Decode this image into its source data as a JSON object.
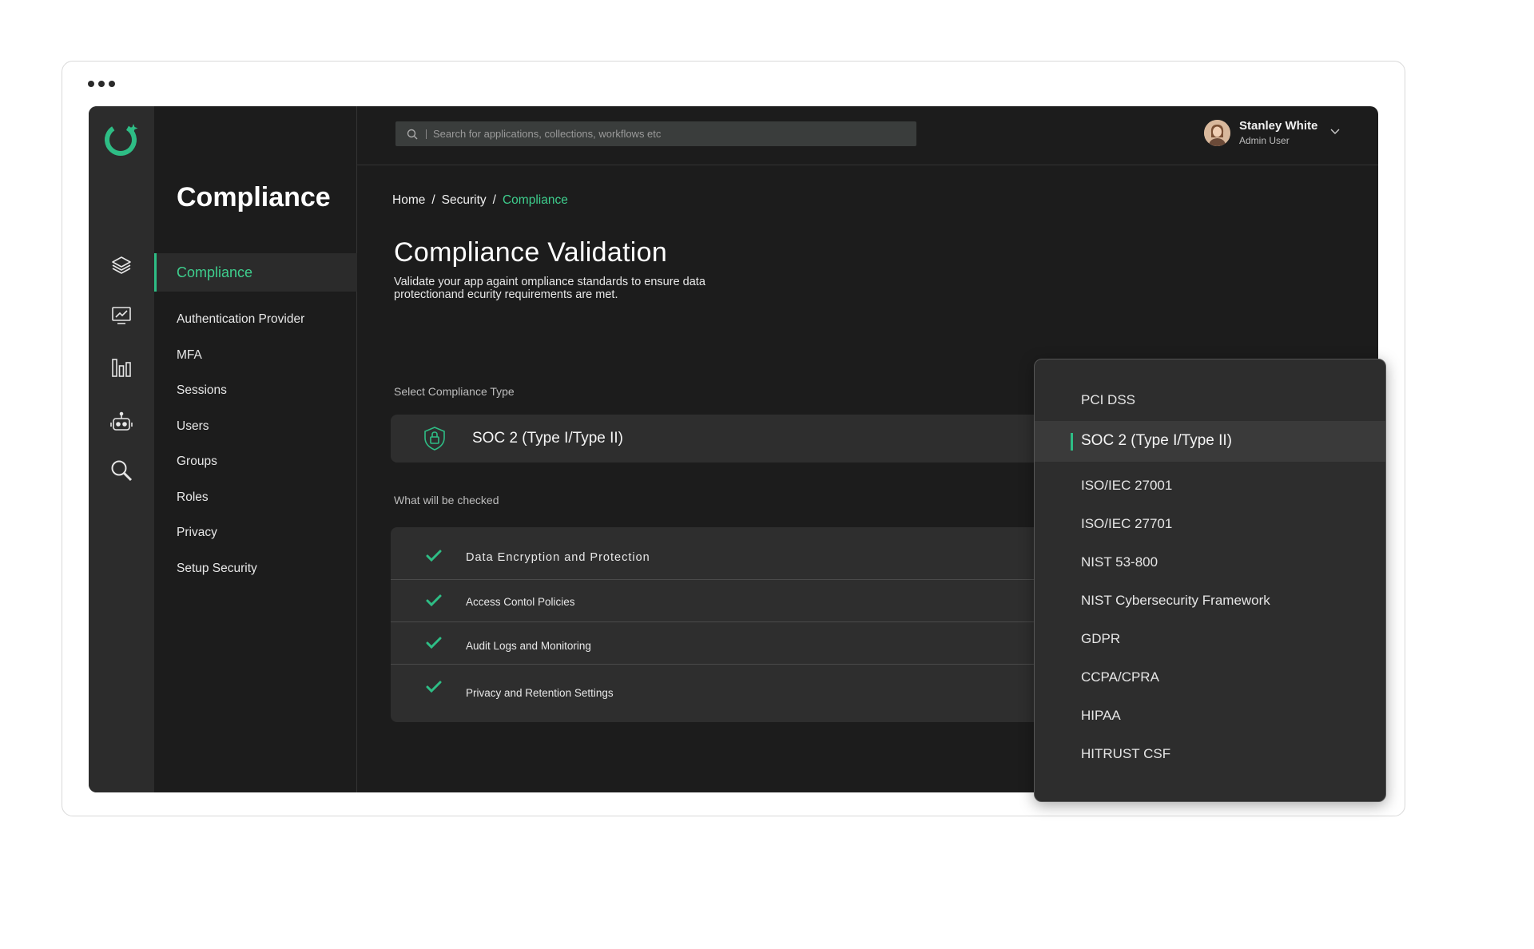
{
  "app": {
    "section_title": "Compliance",
    "brand_color": "#2ebd85"
  },
  "rail": {
    "icons": [
      "layers-icon",
      "monitor-chart-icon",
      "bar-chart-icon",
      "robot-icon",
      "search-icon"
    ]
  },
  "subnav": {
    "active": "Compliance",
    "items": [
      "Authentication Provider",
      "MFA",
      "Sessions",
      "Users",
      "Groups",
      "Roles",
      "Privacy",
      "Setup Security"
    ]
  },
  "search": {
    "placeholder": "Search for applications, collections, workflows etc"
  },
  "user": {
    "name": "Stanley White",
    "role": "Admin User"
  },
  "breadcrumb": {
    "home": "Home",
    "sep1": "/",
    "security": "Security",
    "sep2": "/",
    "current": "Compliance"
  },
  "main": {
    "title": "Compliance Validation",
    "description": "Validate your app againt ompliance standards to ensure data protectionand ecurity requirements are met.",
    "select_label": "Select Compliance Type",
    "selected_value": "SOC 2 (Type I/Type II)",
    "checked_label": "What will be checked",
    "checks": [
      "Data Encryption and Protection",
      "Access Contol Policies",
      "Audit Logs and Monitoring",
      "Privacy and Retention Settings"
    ]
  },
  "dropdown": {
    "options": [
      "PCI DSS",
      "SOC 2 (Type I/Type II)",
      "ISO/IEC 27001",
      "ISO/IEC 27701",
      "NIST 53-800",
      "NIST Cybersecurity Framework",
      "GDPR",
      "CCPA/CPRA",
      "HIPAA",
      "HITRUST CSF"
    ],
    "selected_index": 1
  }
}
